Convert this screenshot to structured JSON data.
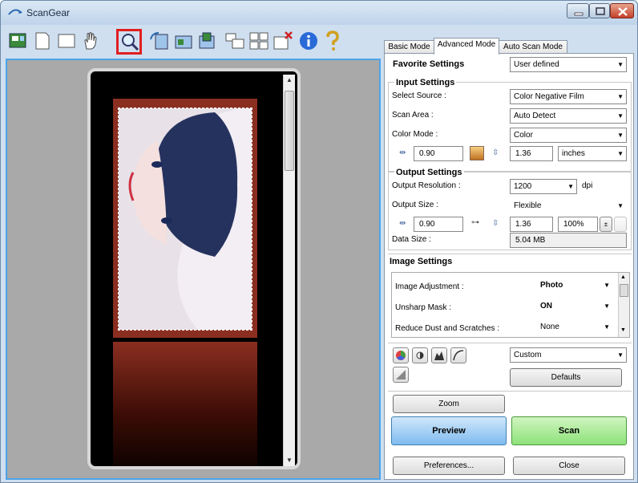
{
  "window": {
    "title": "ScanGear"
  },
  "toolbar": {
    "tools": [
      {
        "name": "thumbnail-view-icon"
      },
      {
        "name": "whole-image-view-icon"
      },
      {
        "name": "crop-frame-icon"
      },
      {
        "name": "hand-icon"
      },
      {
        "name": "zoom-icon"
      },
      {
        "name": "rotate-left-icon"
      },
      {
        "name": "rotate-right-icon"
      },
      {
        "name": "auto-crop-icon"
      },
      {
        "name": "select-all-frames-icon"
      },
      {
        "name": "multi-crop-icon"
      },
      {
        "name": "remove-crop-icon"
      },
      {
        "name": "info-icon"
      },
      {
        "name": "help-icon"
      }
    ]
  },
  "tabs": [
    {
      "label": "Basic Mode",
      "active": false
    },
    {
      "label": "Advanced Mode",
      "active": true
    },
    {
      "label": "Auto Scan Mode",
      "active": false
    }
  ],
  "favorite": {
    "label": "Favorite Settings",
    "value": "User defined"
  },
  "input": {
    "title": "Input Settings",
    "select_source_label": "Select Source :",
    "select_source": "Color Negative Film",
    "scan_area_label": "Scan Area :",
    "scan_area": "Auto Detect",
    "color_mode_label": "Color Mode :",
    "color_mode": "Color",
    "width": "0.90",
    "height": "1.36",
    "unit": "inches"
  },
  "output": {
    "title": "Output Settings",
    "resolution_label": "Output Resolution :",
    "resolution": "1200",
    "resolution_unit": "dpi",
    "size_label": "Output Size :",
    "size": "Flexible",
    "width": "0.90",
    "height": "1.36",
    "scale": "100%",
    "data_size_label": "Data Size :",
    "data_size": "5.04 MB"
  },
  "image_settings": {
    "title": "Image Settings",
    "rows": [
      {
        "label": "Image Adjustment :",
        "value": "Photo"
      },
      {
        "label": "Unsharp Mask :",
        "value": "ON"
      },
      {
        "label": "Reduce Dust and Scratches :",
        "value": "None"
      }
    ]
  },
  "tone": {
    "preset": "Custom",
    "defaults_label": "Defaults"
  },
  "buttons": {
    "zoom": "Zoom",
    "preview": "Preview",
    "scan": "Scan",
    "preferences": "Preferences...",
    "close": "Close"
  },
  "colors": {
    "accent": "#4da3e8",
    "highlight": "#e02020",
    "preview": "#7fbbef",
    "scan": "#8ee27a"
  }
}
